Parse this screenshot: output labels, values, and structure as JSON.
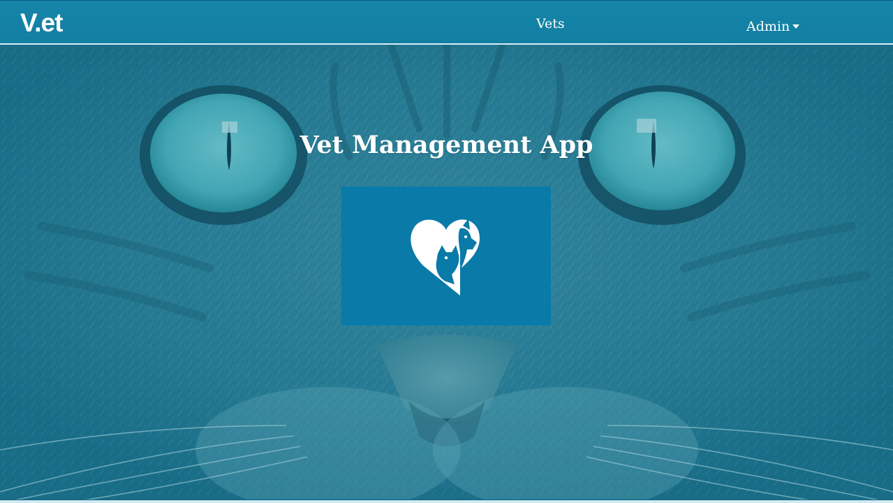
{
  "navbar": {
    "brand": "V.et",
    "links": [
      {
        "label": "Vets"
      },
      {
        "label": "Admin",
        "has_dropdown": true
      }
    ]
  },
  "hero": {
    "title": "Vet Management App",
    "background": "cat-face-photo",
    "overlay_color": "#0f6e8c",
    "logo": "heart-with-pets-icon",
    "logo_background": "#0a7aa8"
  },
  "colors": {
    "navbar": "#1585a8",
    "text": "#ffffff",
    "accent": "#0a7aa8"
  }
}
